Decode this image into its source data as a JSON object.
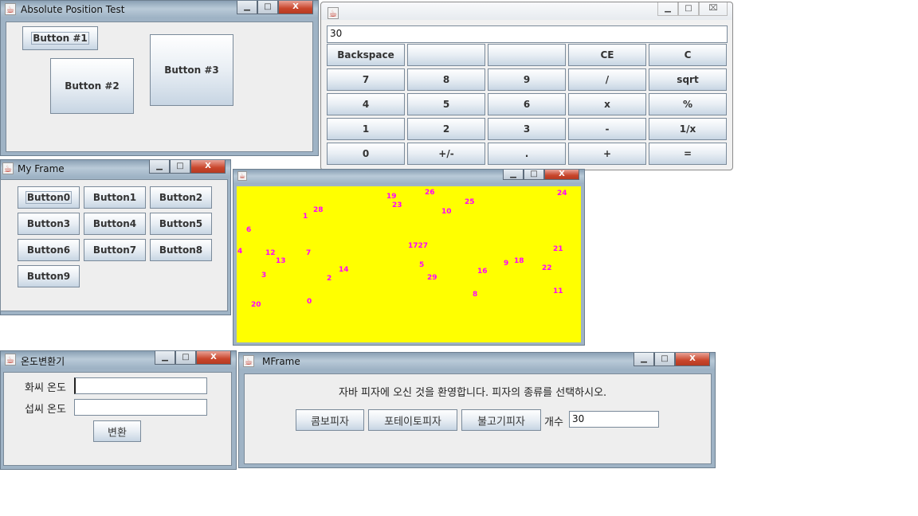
{
  "absolute_test": {
    "title": "Absolute Position Test",
    "buttons": [
      "Button #1",
      "Button #2",
      "Button #3"
    ]
  },
  "calculator": {
    "display_value": "30",
    "keys": [
      [
        "Backspace",
        "",
        "",
        "CE",
        "C"
      ],
      [
        "7",
        "8",
        "9",
        "/",
        "sqrt"
      ],
      [
        "4",
        "5",
        "6",
        "x",
        "%"
      ],
      [
        "1",
        "2",
        "3",
        "-",
        "1/x"
      ],
      [
        "0",
        "+/-",
        ".",
        "+",
        "="
      ]
    ]
  },
  "my_frame": {
    "title": "My Frame",
    "buttons": [
      "Button0",
      "Button1",
      "Button2",
      "Button3",
      "Button4",
      "Button5",
      "Button6",
      "Button7",
      "Button8",
      "Button9"
    ]
  },
  "numbers_frame": {
    "background": "#ffff00",
    "label_color": "#ff00ff",
    "labels": [
      {
        "text": "19"
      },
      {
        "text": "26"
      },
      {
        "text": "24"
      },
      {
        "text": "23"
      },
      {
        "text": "25"
      },
      {
        "text": "28"
      },
      {
        "text": "1"
      },
      {
        "text": "10"
      },
      {
        "text": "6"
      },
      {
        "text": "1727"
      },
      {
        "text": "21"
      },
      {
        "text": "4"
      },
      {
        "text": "12"
      },
      {
        "text": "7"
      },
      {
        "text": "13"
      },
      {
        "text": "5"
      },
      {
        "text": "9"
      },
      {
        "text": "18"
      },
      {
        "text": "14"
      },
      {
        "text": "16"
      },
      {
        "text": "22"
      },
      {
        "text": "3"
      },
      {
        "text": "2"
      },
      {
        "text": "29"
      },
      {
        "text": "8"
      },
      {
        "text": "11"
      },
      {
        "text": "20"
      },
      {
        "text": "0"
      }
    ]
  },
  "temp_converter": {
    "title": "온도변환기",
    "fahrenheit_label": "화씨 온도",
    "celsius_label": "섭씨 온도",
    "fahrenheit_value": "",
    "celsius_value": "",
    "convert_button": "변환"
  },
  "mframe": {
    "title": "MFrame",
    "welcome_text": "자바 피자에 오신 것을 환영합니다. 피자의 종류를 선택하시오.",
    "pizza_buttons": [
      "콤보피자",
      "포테이토피자",
      "불고기피자"
    ],
    "count_label": "개수",
    "count_value": "30"
  },
  "window_controls": {
    "minimize": "▁",
    "maximize": "□",
    "close": "X",
    "light_close": "⌧"
  }
}
